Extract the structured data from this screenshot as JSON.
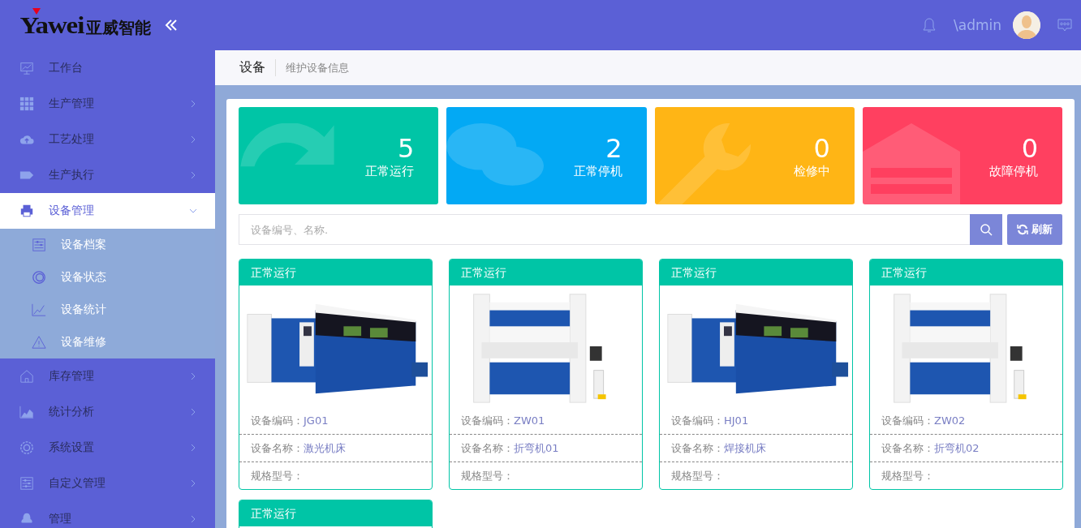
{
  "header": {
    "logo_text": "Yawei",
    "logo_subtitle": "亚威智能",
    "username": "\\admin"
  },
  "sidebar": {
    "items": [
      {
        "label": "工作台",
        "selected": false
      },
      {
        "label": "生产管理",
        "selected": false,
        "expanded": false
      },
      {
        "label": "工艺处理",
        "selected": false,
        "expanded": false
      },
      {
        "label": "生产执行",
        "selected": false,
        "expanded": false
      },
      {
        "label": "设备管理",
        "selected": true,
        "expanded": true,
        "children": [
          {
            "label": "设备档案",
            "selected": false
          },
          {
            "label": "设备状态",
            "selected": false
          },
          {
            "label": "设备统计",
            "selected": false
          },
          {
            "label": "设备维修",
            "selected": false
          }
        ]
      },
      {
        "label": "库存管理",
        "selected": false,
        "expanded": false
      },
      {
        "label": "统计分析",
        "selected": false,
        "expanded": false
      },
      {
        "label": "系统设置",
        "selected": false,
        "expanded": false
      },
      {
        "label": "自定义管理",
        "selected": false,
        "expanded": false
      },
      {
        "label": "管理",
        "selected": false,
        "expanded": false
      }
    ]
  },
  "breadcrumb": {
    "title": "设备",
    "subtitle": "维护设备信息"
  },
  "stats": [
    {
      "value": "5",
      "label": "正常运行",
      "color": "#00c5a6"
    },
    {
      "value": "2",
      "label": "正常停机",
      "color": "#03a9f4"
    },
    {
      "value": "0",
      "label": "检修中",
      "color": "#ffb515"
    },
    {
      "value": "0",
      "label": "故障停机",
      "color": "#ff4060"
    }
  ],
  "search": {
    "placeholder": "设备编号、名称.",
    "refresh_label": "刷新"
  },
  "devices": [
    {
      "status": "正常运行",
      "kind": "laser",
      "code_label": "设备编码：",
      "code": "JG01",
      "name_label": "设备名称：",
      "name": "激光机床",
      "model_label": "规格型号："
    },
    {
      "status": "正常运行",
      "kind": "press",
      "code_label": "设备编码：",
      "code": "ZW01",
      "name_label": "设备名称：",
      "name": "折弯机01",
      "model_label": "规格型号："
    },
    {
      "status": "正常运行",
      "kind": "laser",
      "code_label": "设备编码：",
      "code": "HJ01",
      "name_label": "设备名称：",
      "name": "焊接机床",
      "model_label": "规格型号："
    },
    {
      "status": "正常运行",
      "kind": "press",
      "code_label": "设备编码：",
      "code": "ZW02",
      "name_label": "设备名称：",
      "name": "折弯机02",
      "model_label": "规格型号："
    },
    {
      "status": "正常运行"
    }
  ]
}
